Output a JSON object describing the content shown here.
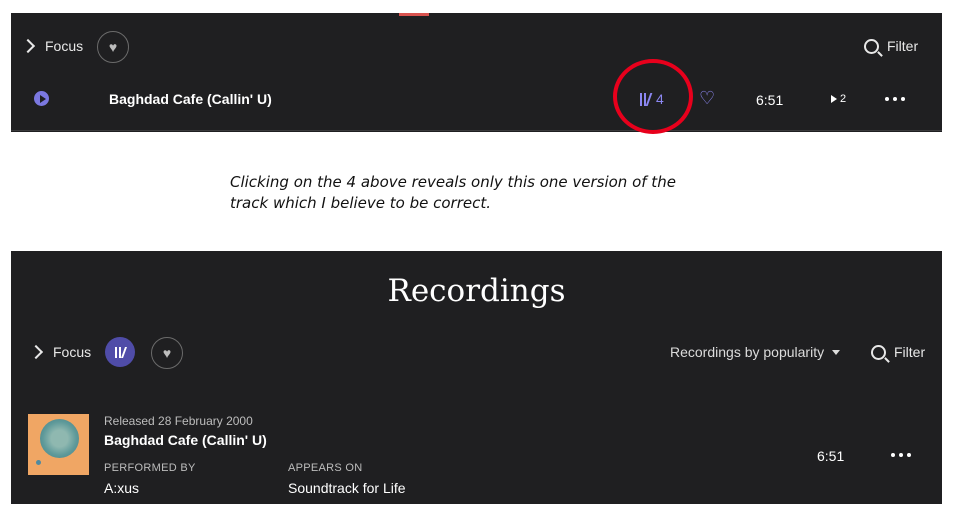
{
  "top": {
    "focus_label": "Focus",
    "filter_label": "Filter",
    "track": {
      "title": "Baghdad Cafe (Callin' U)",
      "versions_count": "4",
      "duration": "6:51",
      "plays": "2"
    }
  },
  "annotation": {
    "line1": "Clicking on the 4 above reveals only this one version of the",
    "line2": "track which I believe to be correct."
  },
  "recordings": {
    "heading": "Recordings",
    "focus_label": "Focus",
    "sort_label": "Recordings by popularity",
    "filter_label": "Filter",
    "item": {
      "released": "Released 28 February 2000",
      "title": "Baghdad Cafe (Callin' U)",
      "performed_by_label": "PERFORMED BY",
      "performer": "A:xus",
      "appears_on_label": "APPEARS ON",
      "album": "Soundtrack for Life",
      "duration": "6:51"
    }
  },
  "colors": {
    "panel_bg": "#1f1f21",
    "accent": "#8c87f2",
    "highlight": "#e8001c"
  }
}
